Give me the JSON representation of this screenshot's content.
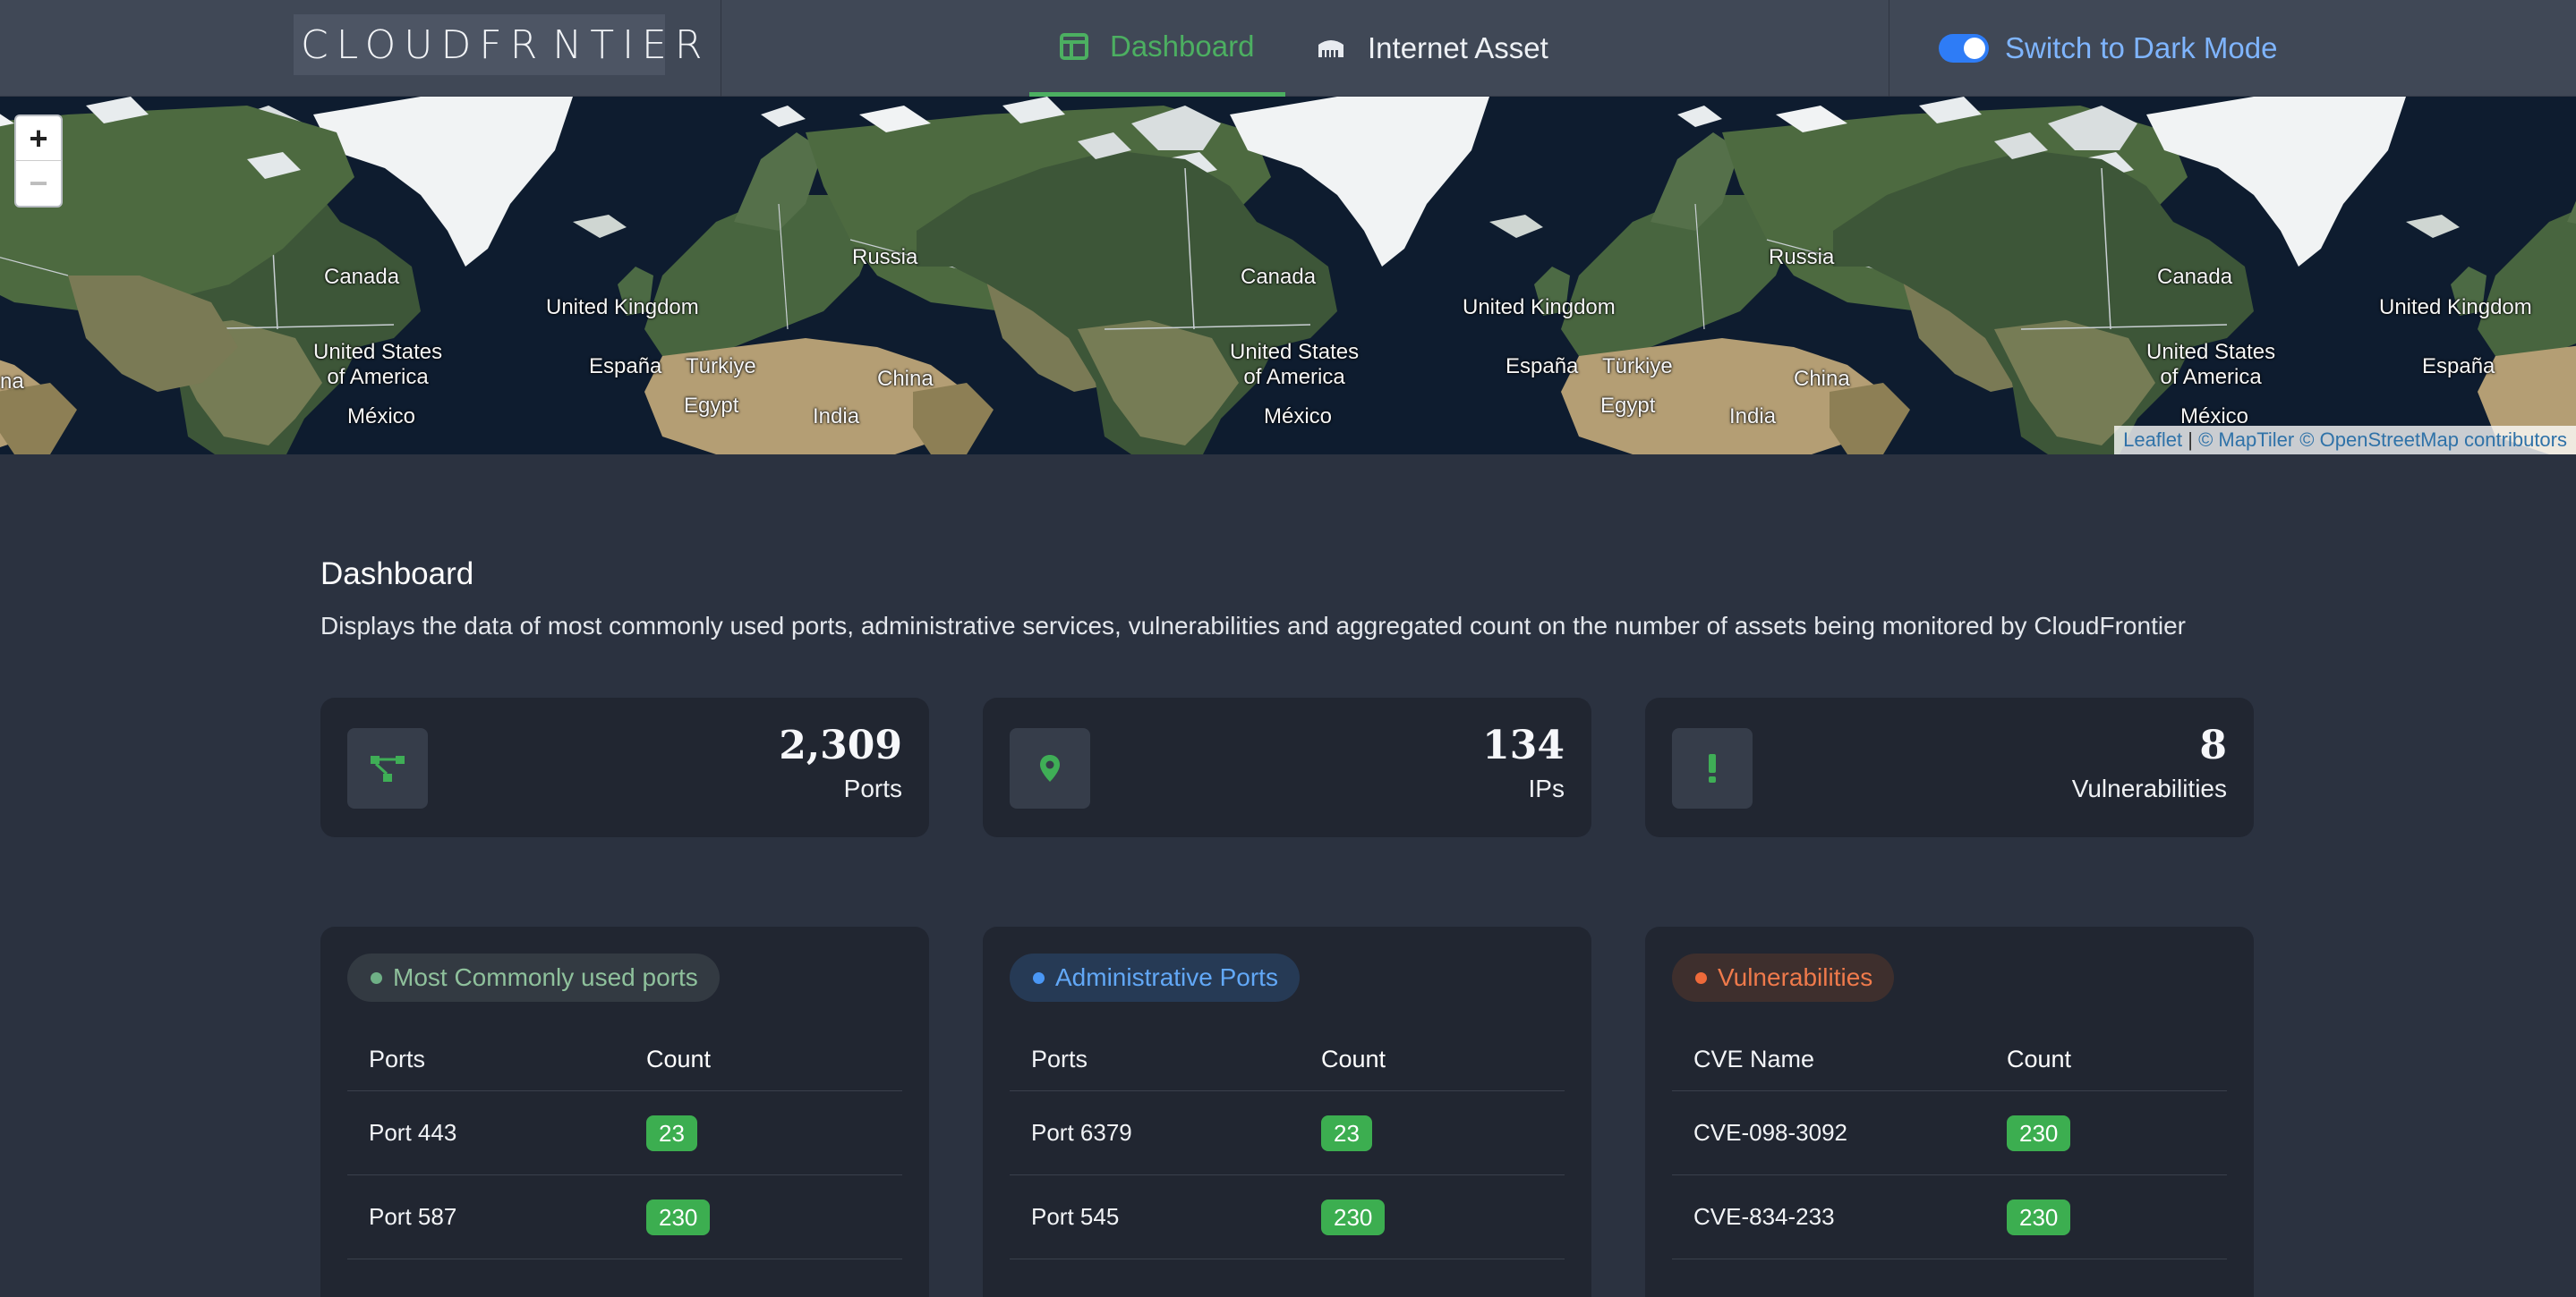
{
  "header": {
    "logo_text": "CLOUDFRONTIER",
    "logo_left": "CLOUDFR",
    "logo_right": "NTIER",
    "nav": [
      {
        "label": "Dashboard",
        "icon": "dashboard-icon",
        "active": true
      },
      {
        "label": "Internet Asset",
        "icon": "network-icon",
        "active": false
      }
    ],
    "theme_toggle_label": "Switch to Dark Mode",
    "theme_toggle_on": true
  },
  "map": {
    "labels": {
      "canada": "Canada",
      "russia": "Russia",
      "uk": "United Kingdom",
      "usa_1": "United States",
      "usa_2": "of America",
      "espana": "España",
      "turkiye": "Türkiye",
      "china": "China",
      "egypt": "Egypt",
      "india": "India",
      "mexico": "México",
      "edge_left": "na"
    },
    "zoom_in": "+",
    "zoom_out": "−",
    "attribution_leaflet": "Leaflet",
    "attribution_sep": " | ",
    "attribution_rest": "© MapTiler © OpenStreetMap contributors",
    "colors": {
      "ocean": "#0e1c2f",
      "land": "#3f5a3c",
      "desert": "#b49e74",
      "ice": "#ffffff"
    }
  },
  "page": {
    "title": "Dashboard",
    "description": "Displays the data of most commonly used ports, administrative services, vulnerabilities and aggregated count on the number of assets being monitored by CloudFrontier"
  },
  "stats": [
    {
      "value": "2,309",
      "label": "Ports",
      "icon": "port-network-icon"
    },
    {
      "value": "134",
      "label": "IPs",
      "icon": "location-pin-icon"
    },
    {
      "value": "8",
      "label": "Vulnerabilities",
      "icon": "exclamation-icon"
    }
  ],
  "cards": {
    "common_ports": {
      "badge": "Most Commonly used ports",
      "col1": "Ports",
      "col2": "Count",
      "rows": [
        {
          "name": "Port 443",
          "count": "23"
        },
        {
          "name": "Port 587",
          "count": "230"
        }
      ]
    },
    "admin_ports": {
      "badge": "Administrative Ports",
      "col1": "Ports",
      "col2": "Count",
      "rows": [
        {
          "name": "Port 6379",
          "count": "23"
        },
        {
          "name": "Port 545",
          "count": "230"
        }
      ]
    },
    "vulnerabilities": {
      "badge": "Vulnerabilities",
      "col1": "CVE Name",
      "col2": "Count",
      "rows": [
        {
          "name": "CVE-098-3092",
          "count": "230"
        },
        {
          "name": "CVE-834-233",
          "count": "230"
        }
      ]
    }
  },
  "colors": {
    "accent_green": "#4caf61",
    "accent_blue": "#4a97f5",
    "accent_orange": "#ee6a3a",
    "page_bg": "#2b3240",
    "card_bg": "#212631"
  }
}
